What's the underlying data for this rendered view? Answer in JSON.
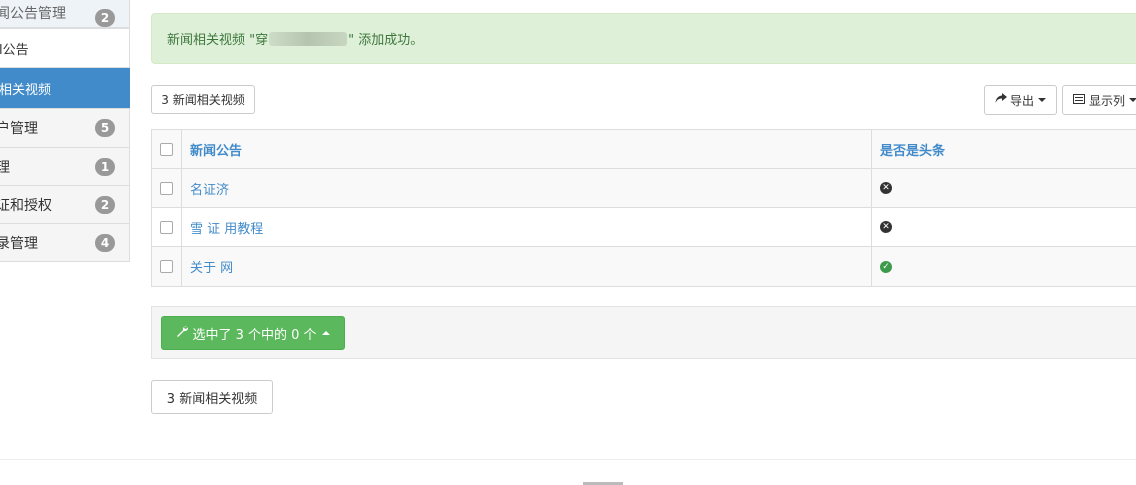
{
  "sidebar": {
    "items": [
      {
        "label": "闻公告管理",
        "badge": "2"
      },
      {
        "label": "l公告",
        "badge": ""
      },
      {
        "label": "相关视频",
        "badge": ""
      },
      {
        "label": "户管理",
        "badge": "5"
      },
      {
        "label": "理",
        "badge": "1"
      },
      {
        "label": "证和授权",
        "badge": "2"
      },
      {
        "label": "录管理",
        "badge": "4"
      }
    ]
  },
  "alert": {
    "prefix": "新闻相关视频 \"",
    "redacted_lead": "穿",
    "suffix": "\" 添加成功。"
  },
  "toolbar": {
    "count_label": "3 新闻相关视频",
    "export_label": "导出",
    "columns_label": "显示列"
  },
  "table": {
    "headers": {
      "title": "新闻公告",
      "flag": "是否是头条"
    },
    "rows": [
      {
        "title": "名证济",
        "headline": "no"
      },
      {
        "title": "雪 证 用教程",
        "headline": "no"
      },
      {
        "title": "关于 网",
        "headline": "yes"
      }
    ]
  },
  "actions": {
    "selection_label": "选中了 3 个中的 0 个"
  },
  "footer": {
    "count_label": "3 新闻相关视频"
  },
  "colors": {
    "primary": "#428bca",
    "success": "#5cb85c",
    "alert_bg": "#dff0d8"
  }
}
